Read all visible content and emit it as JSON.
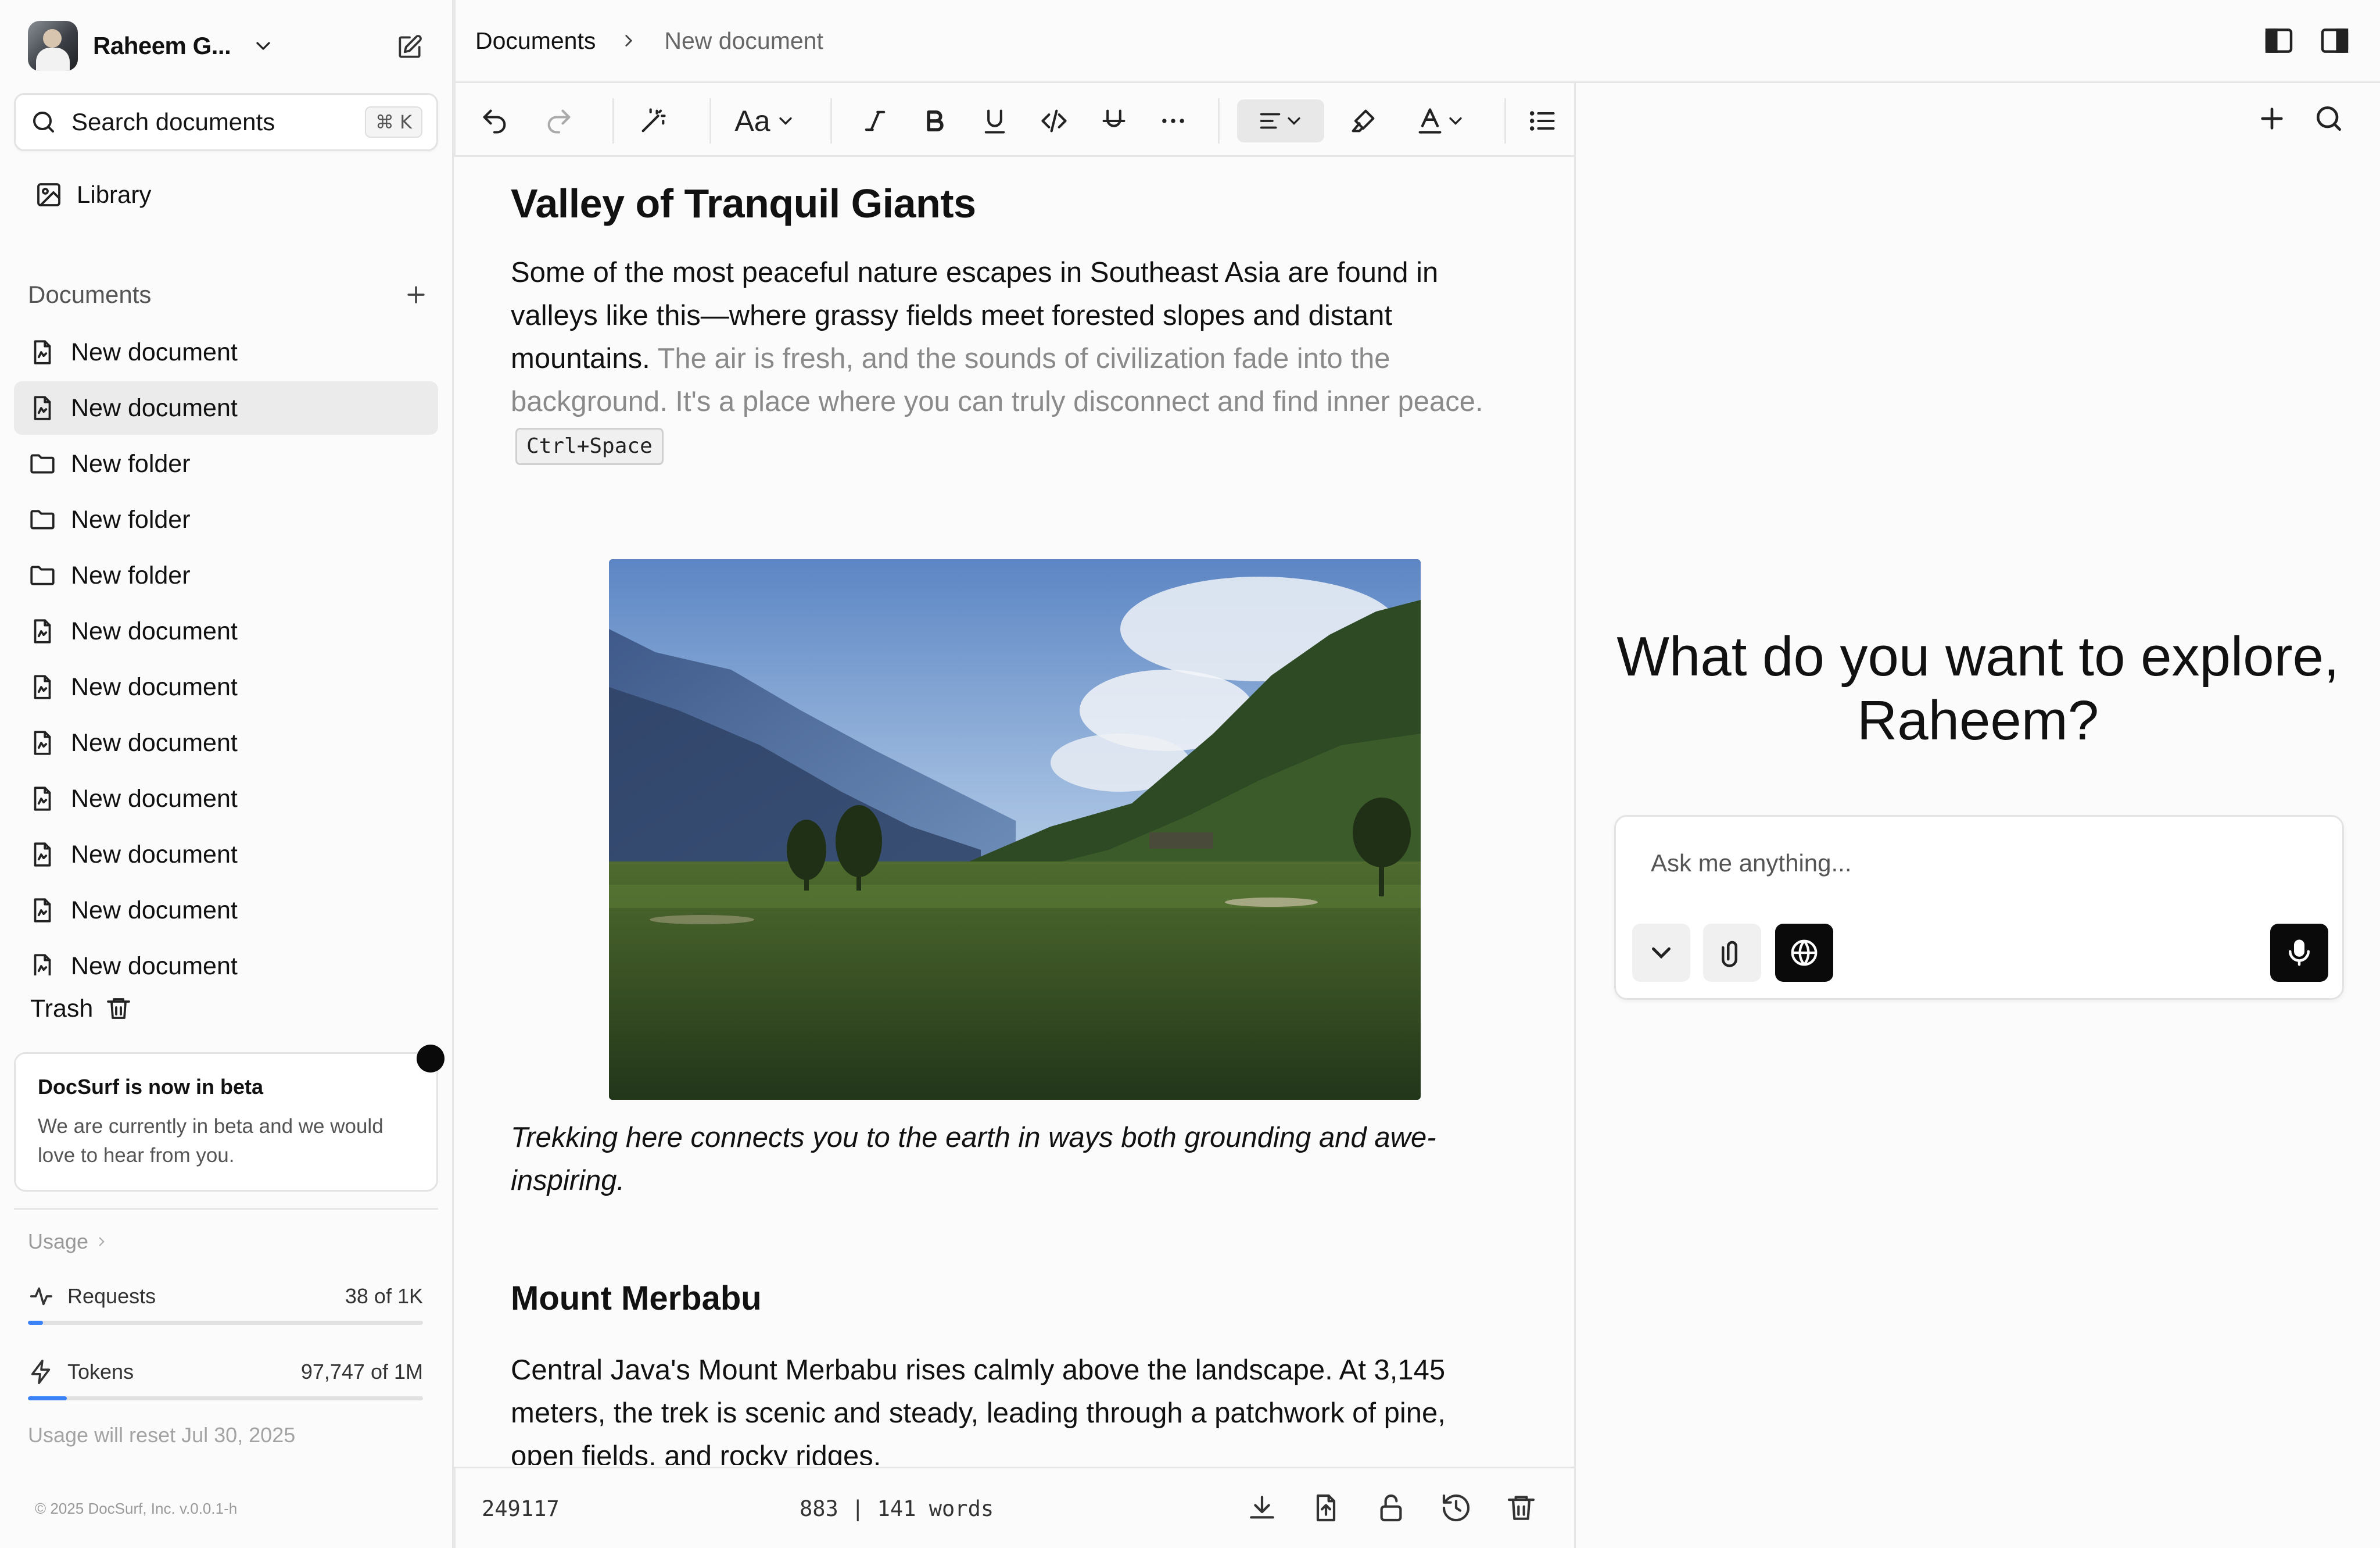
{
  "sidebar": {
    "user_name": "Raheem G...",
    "search_label": "Search documents",
    "search_shortcut": "⌘ K",
    "library_label": "Library",
    "documents_header": "Documents",
    "items": [
      {
        "label": "New document",
        "type": "document",
        "active": false
      },
      {
        "label": "New document",
        "type": "document",
        "active": true
      },
      {
        "label": "New folder",
        "type": "folder",
        "active": false
      },
      {
        "label": "New folder",
        "type": "folder",
        "active": false
      },
      {
        "label": "New folder",
        "type": "folder",
        "active": false
      },
      {
        "label": "New document",
        "type": "document",
        "active": false
      },
      {
        "label": "New document",
        "type": "document",
        "active": false
      },
      {
        "label": "New document",
        "type": "document",
        "active": false
      },
      {
        "label": "New document",
        "type": "document",
        "active": false
      },
      {
        "label": "New document",
        "type": "document",
        "active": false
      },
      {
        "label": "New document",
        "type": "document",
        "active": false
      },
      {
        "label": "New document",
        "type": "document",
        "active": false
      }
    ],
    "trash_label": "Trash",
    "beta": {
      "title": "DocSurf is now in beta",
      "body": "We are currently in beta and we would love to hear from you."
    },
    "usage": {
      "label": "Usage",
      "requests": {
        "label": "Requests",
        "value": "38 of 1K",
        "fraction": 0.038
      },
      "tokens": {
        "label": "Tokens",
        "value": "97,747 of 1M",
        "fraction": 0.098
      },
      "reset_text": "Usage will reset Jul 30, 2025"
    },
    "copyright": "© 2025 DocSurf, Inc. v.0.0.1-h"
  },
  "editor": {
    "breadcrumb": [
      "Documents",
      "New document"
    ],
    "title": "Valley of Tranquil Giants",
    "paragraph_main": "Some of the most peaceful nature escapes in Southeast Asia are found in valleys like this—where grassy fields meet forested slopes and distant mountains.",
    "paragraph_suggestion": "The air is fresh, and the sounds of civilization fade into the background. It's a place where you can truly disconnect and find inner peace.",
    "shortcut_tag": "Ctrl+Space",
    "caption": "Trekking here connects you to the earth in ways both grounding and awe-inspiring.",
    "heading2": "Mount Merbabu",
    "paragraph2": "Central Java's Mount Merbabu rises calmly above the landscape. At 3,145 meters, the trek is scenic and steady, leading through a patchwork of pine, open fields, and rocky ridges.",
    "toolbar": {
      "font_label": "Aa"
    },
    "footer": {
      "id": "249117",
      "stats": "883 | 141 words"
    }
  },
  "assistant": {
    "title": "What do you want to explore, Raheem?",
    "placeholder": "Ask me anything..."
  },
  "colors": {
    "accent": "#3b82f6",
    "dark": "#0a0a0a",
    "active_item": "#ebebeb"
  }
}
